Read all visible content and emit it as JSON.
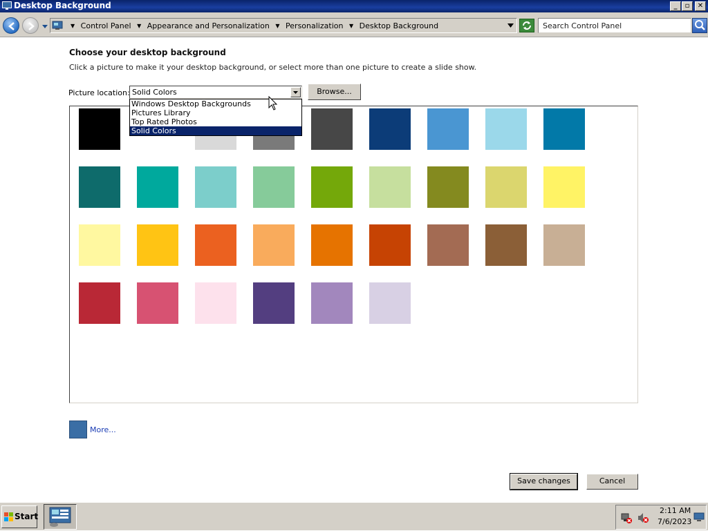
{
  "window": {
    "title": "Desktop Background",
    "minimize_label": "_",
    "maximize_label": "▫",
    "close_label": "✕"
  },
  "address": {
    "breadcrumbs": [
      "Control Panel",
      "Appearance and Personalization",
      "Personalization",
      "Desktop Background"
    ]
  },
  "search": {
    "placeholder": "Search Control Panel"
  },
  "content": {
    "heading": "Choose your desktop background",
    "subtext": "Click a picture to make it your desktop background, or select more than one picture to create a slide show.",
    "location_label": "Picture location:",
    "location_value": "Solid Colors",
    "browse_label": "Browse...",
    "location_options": [
      "Windows Desktop Backgrounds",
      "Pictures Library",
      "Top Rated Photos",
      "Solid Colors"
    ],
    "selected_option": "Solid Colors"
  },
  "swatches": [
    {
      "color": "#000000"
    },
    {
      "color": "#ffffff"
    },
    {
      "color": "#d9d9d9"
    },
    {
      "color": "#7a7a7a"
    },
    {
      "color": "#474747"
    },
    {
      "color": "#0c3c78"
    },
    {
      "color": "#4a96d2"
    },
    {
      "color": "#9bd8ea"
    },
    {
      "color": "#0279a8"
    },
    {
      "color": "#0e6b6b"
    },
    {
      "color": "#00a99d"
    },
    {
      "color": "#7ccecb"
    },
    {
      "color": "#86cb9a"
    },
    {
      "color": "#74a80a"
    },
    {
      "color": "#c6df9e"
    },
    {
      "color": "#848a1f"
    },
    {
      "color": "#dbd66e"
    },
    {
      "color": "#fff365"
    },
    {
      "color": "#fff8a0"
    },
    {
      "color": "#ffc414"
    },
    {
      "color": "#eb6120"
    },
    {
      "color": "#f9ab5c"
    },
    {
      "color": "#e67300"
    },
    {
      "color": "#c64303"
    },
    {
      "color": "#a36b53"
    },
    {
      "color": "#8b5f37"
    },
    {
      "color": "#c8af95"
    },
    {
      "color": "#b92836"
    },
    {
      "color": "#d75272"
    },
    {
      "color": "#fde1ec"
    },
    {
      "color": "#533e80"
    },
    {
      "color": "#a287bd"
    },
    {
      "color": "#d8d0e4"
    }
  ],
  "more": {
    "label": "More...",
    "color": "#3a6ea5"
  },
  "actions": {
    "save_label": "Save changes",
    "cancel_label": "Cancel"
  },
  "taskbar": {
    "start_label": "Start",
    "time": "2:11 AM",
    "date": "7/6/2023"
  }
}
